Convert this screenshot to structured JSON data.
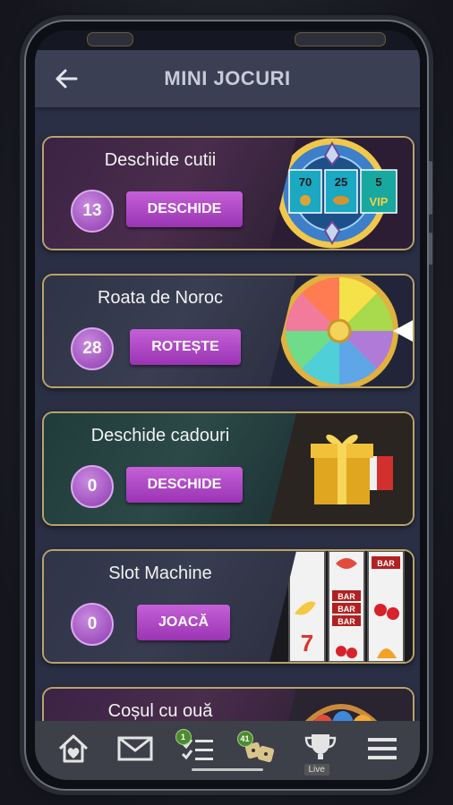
{
  "header": {
    "title": "MINI JOCURI"
  },
  "games": [
    {
      "name": "Deschide cutii",
      "count": "13",
      "button": "DESCHIDE",
      "prize_values": [
        "70",
        "25",
        "5"
      ],
      "prize_label": "VIP"
    },
    {
      "name": "Roata de Noroc",
      "count": "28",
      "button": "ROTEȘTE"
    },
    {
      "name": "Deschide cadouri",
      "count": "0",
      "button": "DESCHIDE"
    },
    {
      "name": "Slot Machine",
      "count": "0",
      "button": "JOACĂ",
      "reel_labels": [
        "BAR",
        "BAR",
        "BAR",
        "BAR"
      ]
    },
    {
      "name": "Coșul cu ouă"
    }
  ],
  "bottom_nav": {
    "items": [
      {
        "icon": "home-heart-icon"
      },
      {
        "icon": "mail-icon"
      },
      {
        "icon": "checklist-icon",
        "badge": "1"
      },
      {
        "icon": "dice-icon",
        "badge": "41"
      },
      {
        "icon": "trophy-icon",
        "tag": "Live"
      },
      {
        "icon": "menu-icon"
      }
    ]
  },
  "colors": {
    "accent_purple": "#b84ccf",
    "card_border_gold": "#b9a36a",
    "header_bg": "#3a3f54",
    "screen_bg": "#2a2f45",
    "nav_bg": "#3d3f49"
  }
}
